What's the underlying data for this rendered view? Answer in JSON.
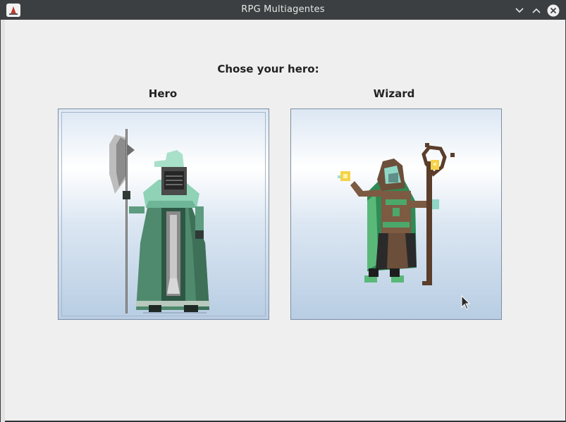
{
  "window": {
    "title": "RPG Multiagentes"
  },
  "main": {
    "heading": "Chose your hero:",
    "characters": [
      {
        "label": "Hero",
        "icon": "armored-knight-icon",
        "selected": true
      },
      {
        "label": "Wizard",
        "icon": "hooded-wizard-icon",
        "selected": false
      }
    ]
  },
  "colors": {
    "titlebar": "#3c3f41",
    "background": "#efefef",
    "card_border": "#7d8ea3"
  }
}
